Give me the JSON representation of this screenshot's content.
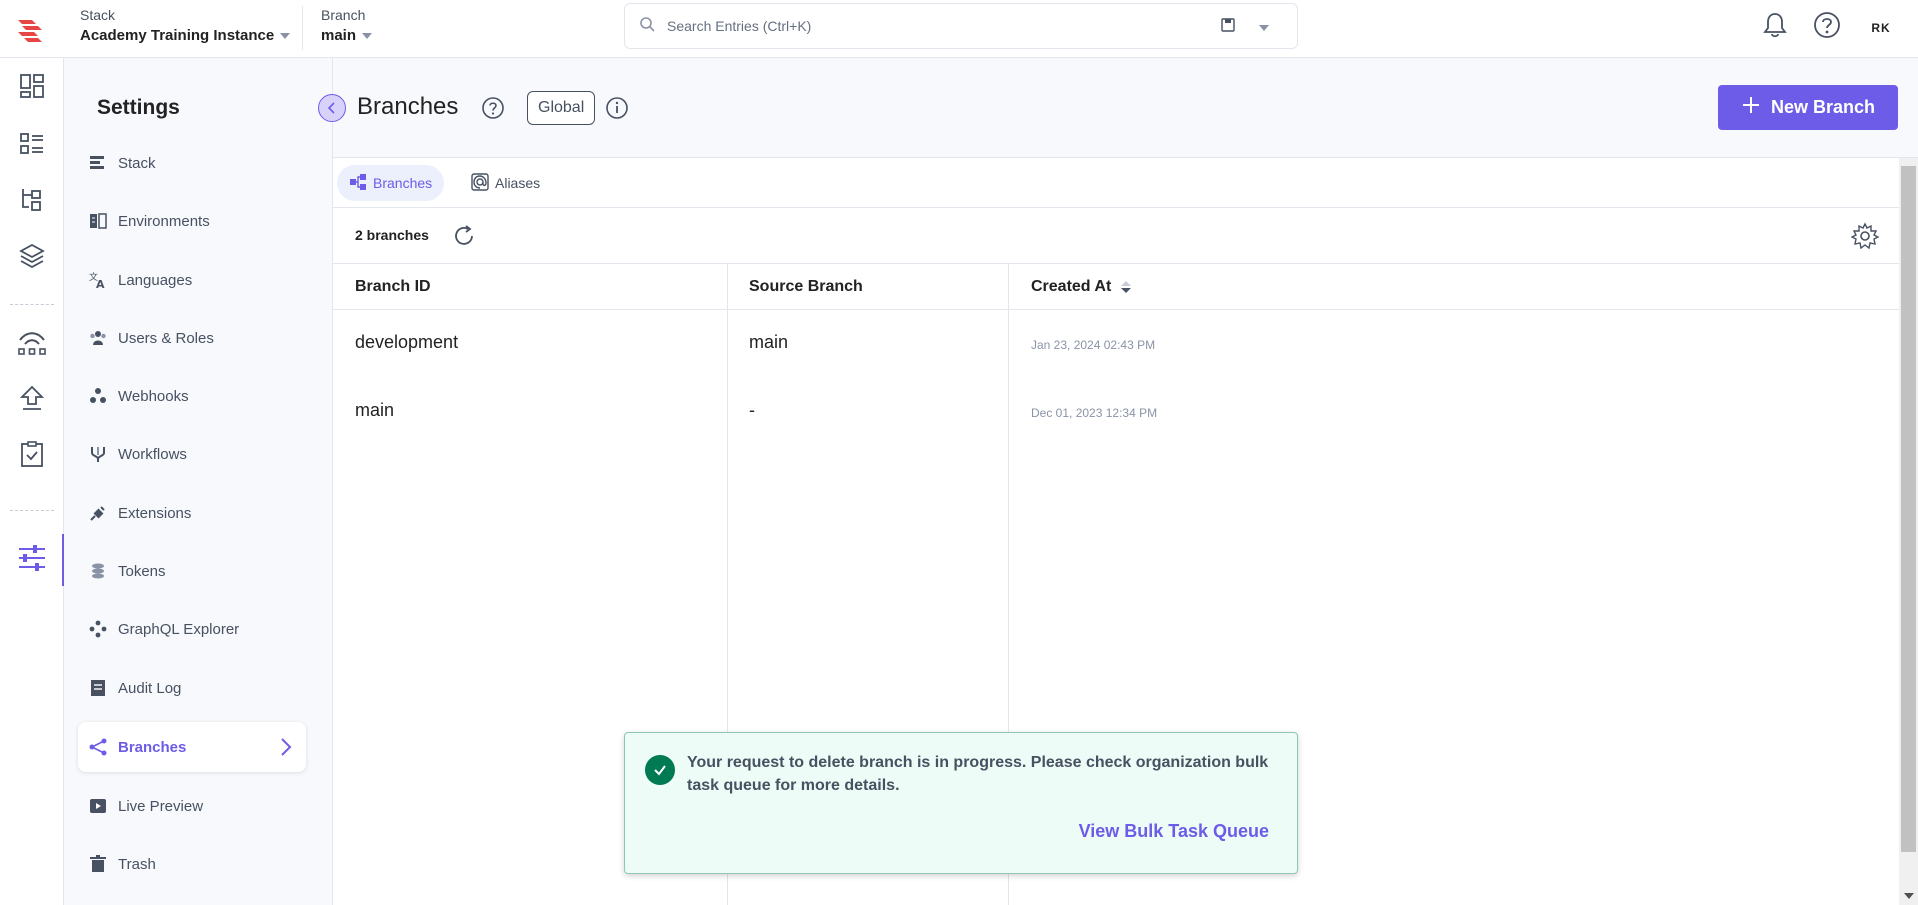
{
  "header": {
    "stack_label": "Stack",
    "stack_value": "Academy Training Instance",
    "branch_label": "Branch",
    "branch_value": "main",
    "search_placeholder": "Search Entries (Ctrl+K)",
    "avatar_initials": "RK"
  },
  "rail": {
    "icons": [
      "dashboard-icon",
      "content-models-icon",
      "entries-icon",
      "assets-icon",
      "publish-queue-icon",
      "deploy-icon",
      "tasks-icon",
      "settings-icon"
    ]
  },
  "settings": {
    "title": "Settings",
    "items": [
      {
        "label": "Stack",
        "icon": "stack-icon"
      },
      {
        "label": "Environments",
        "icon": "environments-icon"
      },
      {
        "label": "Languages",
        "icon": "languages-icon"
      },
      {
        "label": "Users & Roles",
        "icon": "users-icon"
      },
      {
        "label": "Webhooks",
        "icon": "webhooks-icon"
      },
      {
        "label": "Workflows",
        "icon": "workflows-icon"
      },
      {
        "label": "Extensions",
        "icon": "extensions-icon"
      },
      {
        "label": "Tokens",
        "icon": "tokens-icon"
      },
      {
        "label": "GraphQL Explorer",
        "icon": "graphql-icon"
      },
      {
        "label": "Audit Log",
        "icon": "audit-log-icon"
      },
      {
        "label": "Branches",
        "icon": "branches-icon",
        "active": true
      },
      {
        "label": "Live Preview",
        "icon": "live-preview-icon"
      },
      {
        "label": "Trash",
        "icon": "trash-icon"
      }
    ]
  },
  "page": {
    "title": "Branches",
    "scope_badge": "Global",
    "new_button_label": "New Branch"
  },
  "tabs": [
    {
      "label": "Branches",
      "active": true
    },
    {
      "label": "Aliases",
      "active": false
    }
  ],
  "toolbar": {
    "count_label": "2 branches"
  },
  "table": {
    "columns": [
      "Branch ID",
      "Source Branch",
      "Created At"
    ],
    "rows": [
      {
        "branch_id": "development",
        "source": "main",
        "created_at": "Jan 23, 2024 02:43 PM"
      },
      {
        "branch_id": "main",
        "source": "-",
        "created_at": "Dec 01, 2023 12:34 PM"
      }
    ]
  },
  "toast": {
    "message": "Your request to delete branch is in progress. Please check organization bulk task queue for more details.",
    "link_label": "View Bulk Task Queue"
  },
  "colors": {
    "accent": "#6c5ce7",
    "success": "#007a52",
    "text": "#222222",
    "muted": "#475161",
    "border": "#e3e6ec"
  }
}
